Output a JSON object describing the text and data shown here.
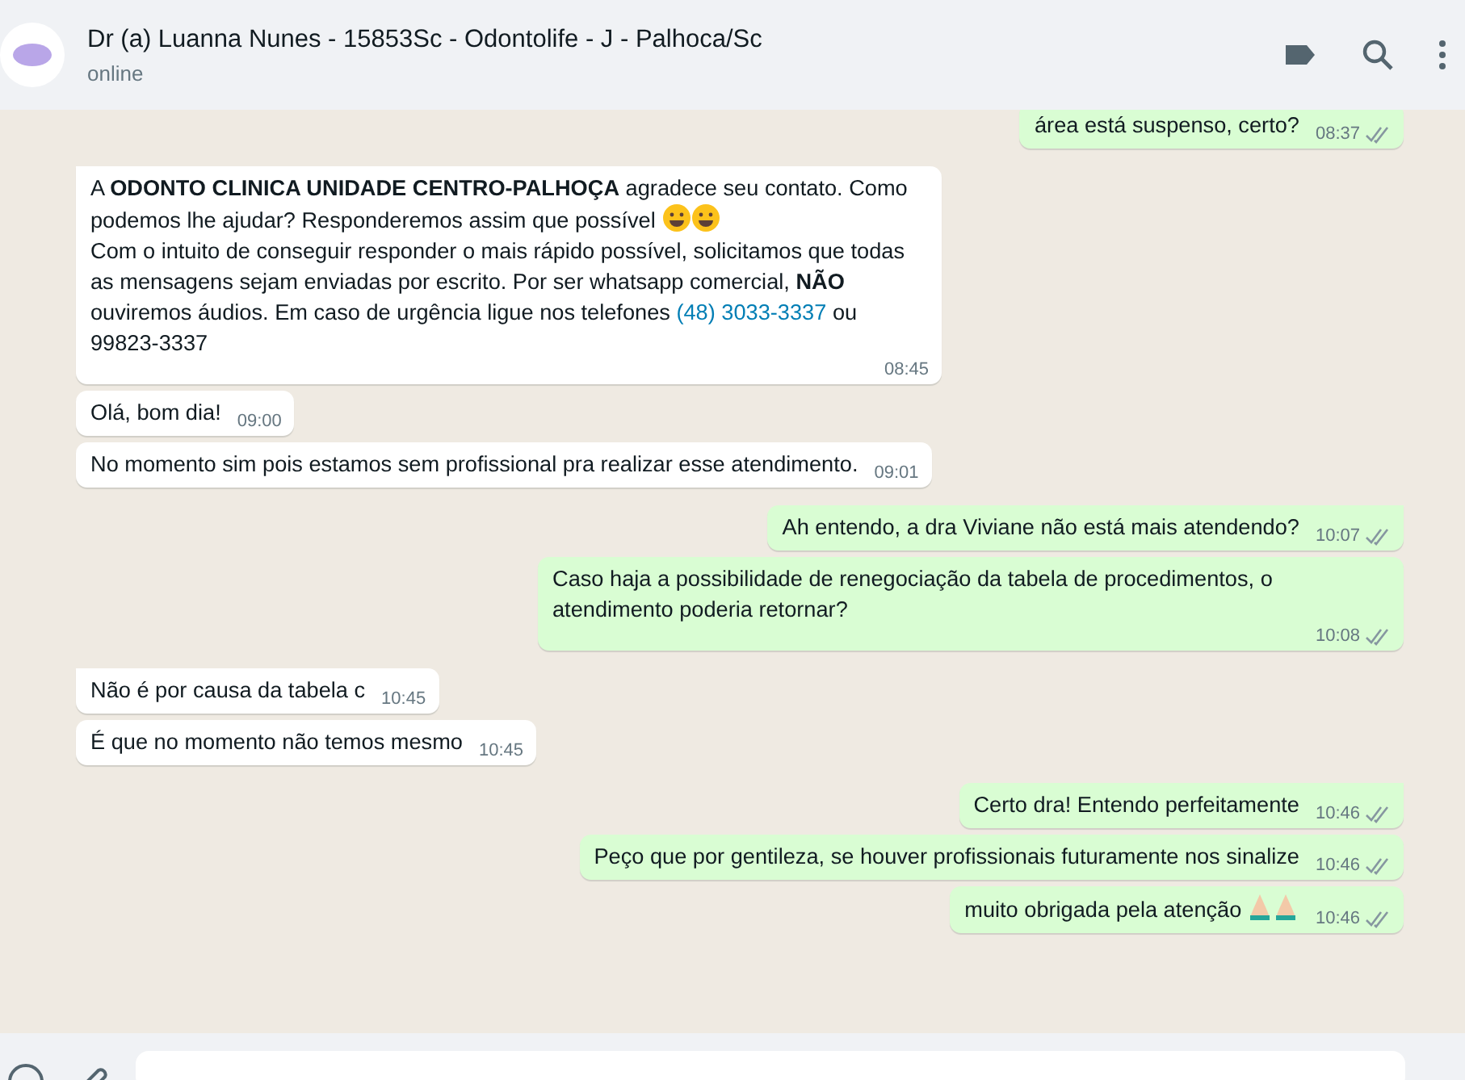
{
  "header": {
    "name": "Dr (a) Luanna Nunes - 15853Sc - Odontolife - J - Palhoca/Sc",
    "status": "online"
  },
  "messages": [
    {
      "kind": "outgoing",
      "parts": [
        {
          "kind": "text",
          "text": "área está suspenso, certo?"
        }
      ],
      "time": "08:37",
      "read": true,
      "tail": false
    },
    {
      "kind": "incoming",
      "parts": [
        {
          "kind": "text",
          "text": "A **ODONTO CLINICA UNIDADE CENTRO-PALHOÇA** agradece seu contato. Como podemos lhe ajudar? Responderemos assim que possível "
        },
        {
          "kind": "emoji"
        },
        {
          "kind": "emoji"
        },
        {
          "kind": "break"
        },
        {
          "kind": "text",
          "text": "Com o intuito de conseguir responder o mais rápido possível, solicitamos que todas as mensagens sejam enviadas por escrito. Por ser whatsapp comercial, **NÃO** ouviremos áudios. Em caso de urgência ligue nos telefones "
        },
        {
          "kind": "link",
          "text": "(48) 3033-3337"
        },
        {
          "kind": "text",
          "text": " ou 99823-3337"
        }
      ],
      "time": "08:45",
      "tail": true
    },
    {
      "kind": "incoming",
      "parts": [
        {
          "kind": "text",
          "text": "Olá, bom dia!"
        }
      ],
      "time": "09:00",
      "tail": false
    },
    {
      "kind": "incoming",
      "parts": [
        {
          "kind": "text",
          "text": "No momento sim pois estamos sem profissional pra realizar esse atendimento."
        }
      ],
      "time": "09:01",
      "tail": false
    },
    {
      "kind": "outgoing",
      "parts": [
        {
          "kind": "text",
          "text": "Ah entendo, a dra Viviane não está mais atendendo?"
        }
      ],
      "time": "10:07",
      "read": true,
      "tail": true
    },
    {
      "kind": "outgoing",
      "parts": [
        {
          "kind": "text",
          "text": "Caso haja a possibilidade de renegociação da tabela de procedimentos, o atendimento poderia retornar?"
        }
      ],
      "time": "10:08",
      "read": true,
      "tail": false
    },
    {
      "kind": "incoming",
      "parts": [
        {
          "kind": "text",
          "text": "Não é por causa da tabela c"
        }
      ],
      "time": "10:45",
      "tail": true
    },
    {
      "kind": "incoming",
      "parts": [
        {
          "kind": "text",
          "text": "É que no momento não temos mesmo"
        }
      ],
      "time": "10:45",
      "tail": false
    },
    {
      "kind": "outgoing",
      "parts": [
        {
          "kind": "text",
          "text": "Certo dra! Entendo perfeitamente"
        }
      ],
      "time": "10:46",
      "read": true,
      "tail": true
    },
    {
      "kind": "outgoing",
      "parts": [
        {
          "kind": "text",
          "text": "Peço que por gentileza, se houver profissionais futuramente nos sinalize"
        }
      ],
      "time": "10:46",
      "read": true,
      "tail": false
    },
    {
      "kind": "outgoing",
      "parts": [
        {
          "kind": "text",
          "text": "muito obrigada pela atenção "
        },
        {
          "kind": "hands"
        },
        {
          "kind": "hands"
        }
      ],
      "time": "10:46",
      "read": true,
      "tail": false
    }
  ]
}
